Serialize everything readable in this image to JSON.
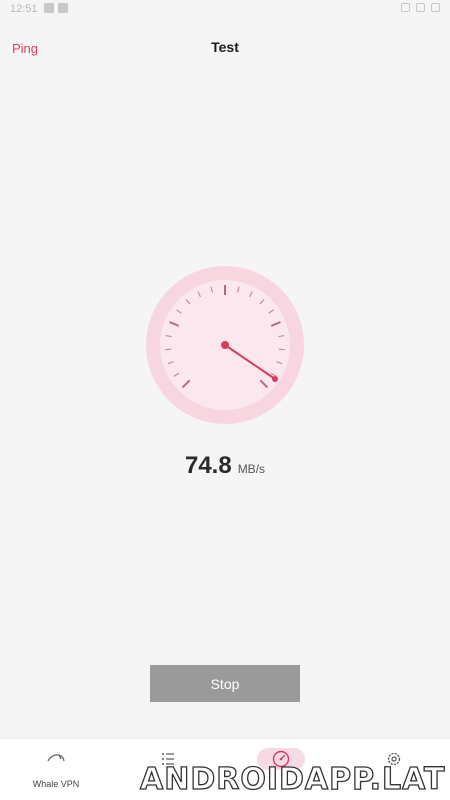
{
  "status_bar": {
    "time": "12:51"
  },
  "header": {
    "ping_label": "Ping",
    "title": "Test"
  },
  "speed": {
    "value": "74.8",
    "unit": "MB/s"
  },
  "stop_label": "Stop",
  "bottom_nav": {
    "items": [
      {
        "label": "Whale VPN",
        "icon": "whale-vpn-icon",
        "active": false
      },
      {
        "label": "",
        "icon": "list-icon",
        "active": false
      },
      {
        "label": "",
        "icon": "speedometer-icon",
        "active": true
      },
      {
        "label": "",
        "icon": "gear-icon",
        "active": false
      }
    ]
  },
  "watermark": "ANDROIDAPP.LAT",
  "colors": {
    "accent": "#e0405f",
    "gauge_outer": "#f7d6e0",
    "gauge_inner": "#fae8ee",
    "stop_button": "#9a9a9a"
  }
}
